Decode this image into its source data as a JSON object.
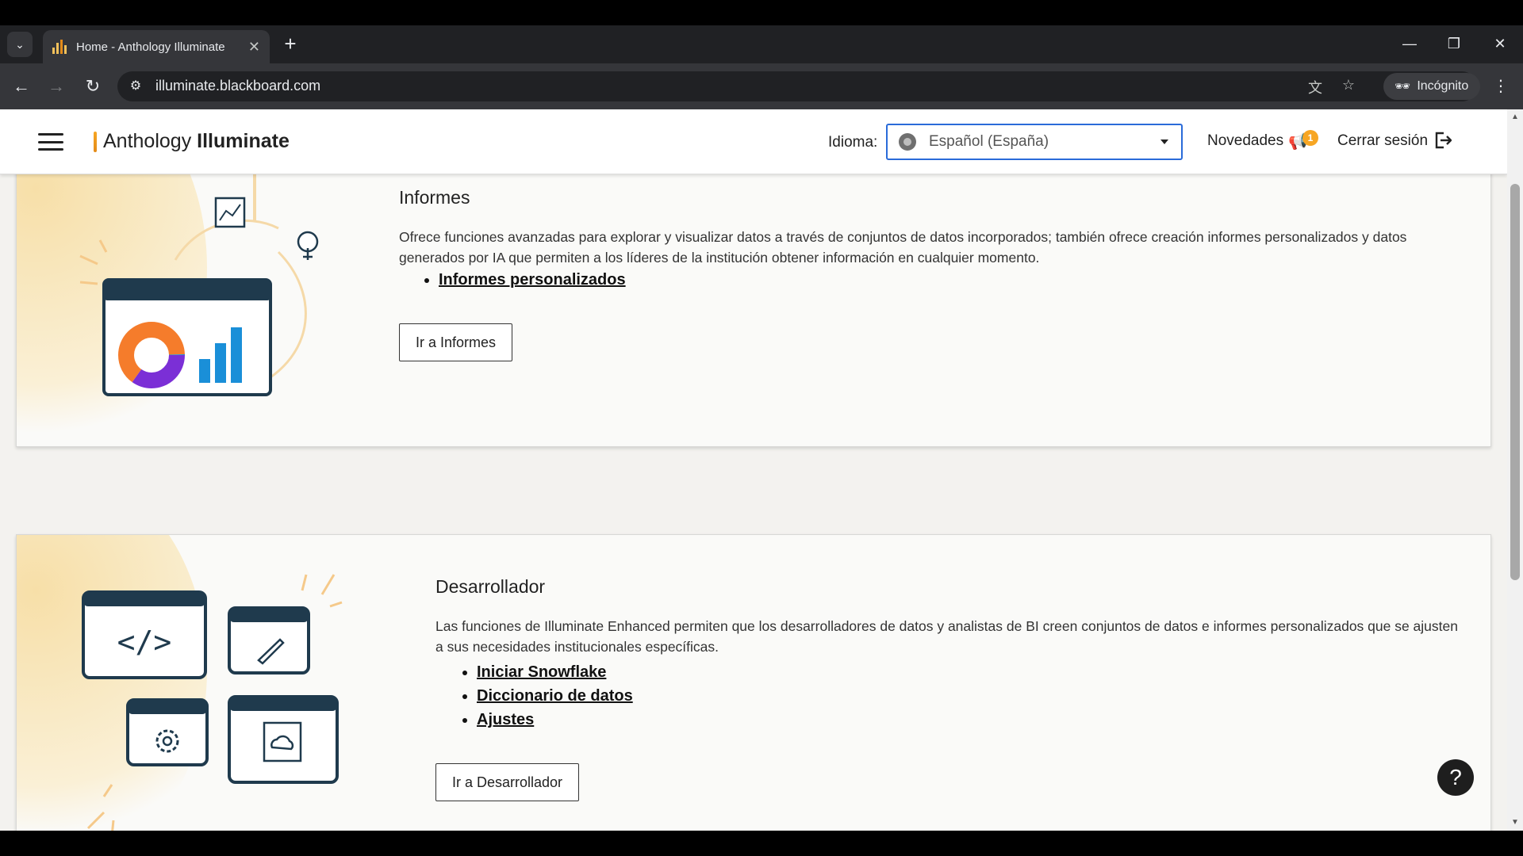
{
  "browser": {
    "tab_title": "Home - Anthology Illuminate",
    "url": "illuminate.blackboard.com",
    "incognito_label": "Incógnito"
  },
  "header": {
    "brand_light": "Anthology",
    "brand_bold": "Illuminate",
    "language_label": "Idioma:",
    "language_value": "Español (España)",
    "news_label": "Novedades",
    "news_badge": "1",
    "logout_label": "Cerrar sesión"
  },
  "reports_card": {
    "title": "Informes",
    "description": "Ofrece funciones avanzadas para explorar y visualizar datos a través de conjuntos de datos incorporados; también ofrece creación informes personalizados y datos generados por IA que permiten a los líderes de la institución obtener información en cualquier momento.",
    "links": [
      "Informes personalizados"
    ],
    "button_label": "Ir a Informes"
  },
  "developer_card": {
    "title": "Desarrollador",
    "description": "Las funciones de Illuminate Enhanced permiten que los desarrolladores de datos y analistas de BI creen conjuntos de datos e informes personalizados que se ajusten a sus necesidades institucionales específicas.",
    "links": [
      "Iniciar Snowflake",
      "Diccionario de datos",
      "Ajustes"
    ],
    "button_label": "Ir a Desarrollador"
  },
  "help_label": "?",
  "colors": {
    "accent_orange": "#f7a623",
    "focus_blue": "#2a6bd9",
    "illustration_navy": "#1f3a4d",
    "chart_blue": "#1a8fd8",
    "donut_purple": "#7b2fd6",
    "donut_orange": "#f57c2b"
  }
}
